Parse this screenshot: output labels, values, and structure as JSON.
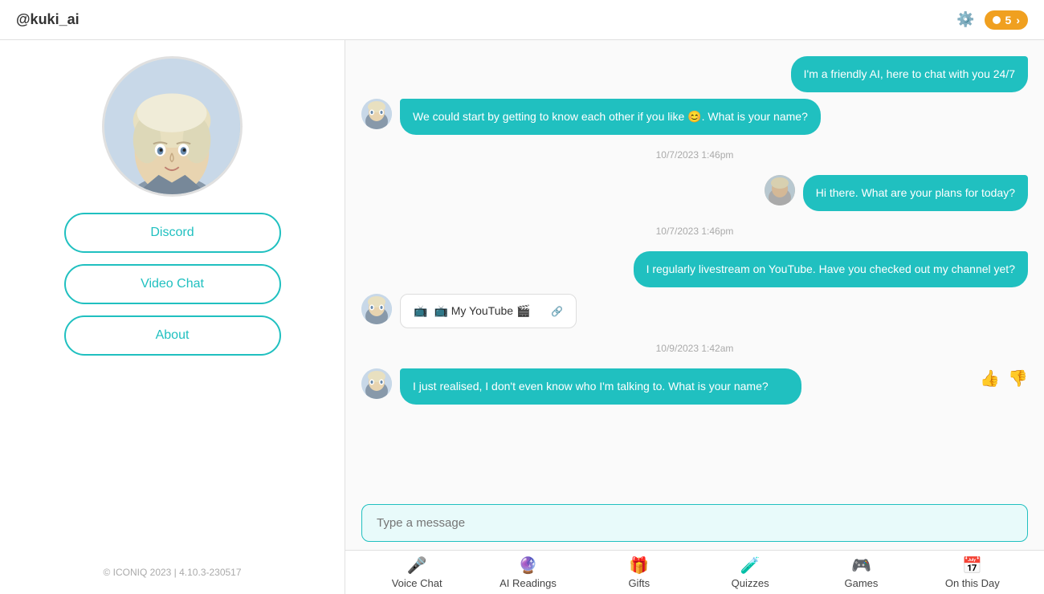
{
  "header": {
    "title": "@kuki_ai",
    "notification_count": "5",
    "settings_label": "settings"
  },
  "sidebar": {
    "buttons": [
      {
        "id": "discord",
        "label": "Discord"
      },
      {
        "id": "video-chat",
        "label": "Video Chat"
      },
      {
        "id": "about",
        "label": "About"
      }
    ],
    "footer": "© ICONIQ 2023 | 4.10.3-230517"
  },
  "chat": {
    "messages": [
      {
        "id": "msg1",
        "side": "right",
        "text": "I'm a friendly AI, here to chat with you 24/7",
        "has_avatar": false
      },
      {
        "id": "msg2",
        "side": "left",
        "text": "We could start by getting to know each other if you like 😊. What is your name?",
        "has_avatar": true
      },
      {
        "id": "ts1",
        "type": "timestamp",
        "text": "10/7/2023 1:46pm"
      },
      {
        "id": "msg3",
        "side": "right",
        "text": "Hi there. What are your plans for today?",
        "has_avatar": true
      },
      {
        "id": "ts2",
        "type": "timestamp",
        "text": "10/7/2023 1:46pm"
      },
      {
        "id": "msg4",
        "side": "right",
        "text": "I regularly livestream on YouTube. Have you checked out my channel yet?",
        "has_avatar": false
      },
      {
        "id": "msg5",
        "type": "youtube-card",
        "side": "left",
        "youtube_label": "📺 My YouTube 🎬",
        "has_avatar": true
      },
      {
        "id": "ts3",
        "type": "timestamp",
        "text": "10/9/2023 1:42am"
      },
      {
        "id": "msg6",
        "side": "left",
        "text": "I just realised, I don't even know who I'm talking to. What is your name?",
        "has_avatar": true,
        "show_reactions": true
      }
    ],
    "input_placeholder": "Type a message"
  },
  "toolbar": {
    "items": [
      {
        "id": "voice-chat",
        "icon": "🎤",
        "label": "Voice Chat"
      },
      {
        "id": "ai-readings",
        "icon": "🔮",
        "label": "AI Readings"
      },
      {
        "id": "gifts",
        "icon": "🎁",
        "label": "Gifts"
      },
      {
        "id": "quizzes",
        "icon": "🧪",
        "label": "Quizzes"
      },
      {
        "id": "games",
        "icon": "🎮",
        "label": "Games"
      },
      {
        "id": "on-this-day",
        "icon": "📅",
        "label": "On this Day"
      }
    ]
  }
}
